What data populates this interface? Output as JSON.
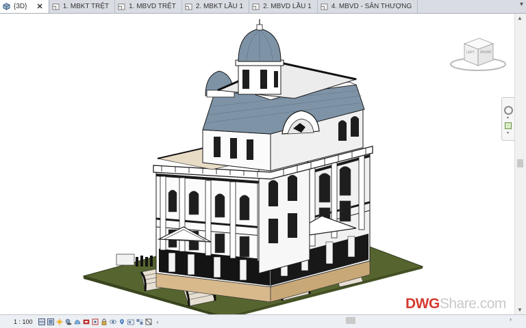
{
  "tabs": [
    {
      "label": "{3D}",
      "active": true,
      "icon": "3d-view-icon"
    },
    {
      "label": "1. MBKT TRỆT",
      "active": false,
      "icon": "floor-plan-icon"
    },
    {
      "label": "1. MBVD TRỆT",
      "active": false,
      "icon": "floor-plan-icon"
    },
    {
      "label": "2. MBKT LẦU 1",
      "active": false,
      "icon": "floor-plan-icon"
    },
    {
      "label": "2. MBVD LẦU 1",
      "active": false,
      "icon": "floor-plan-icon"
    },
    {
      "label": "4. MBVD - SÂN THƯỢNG",
      "active": false,
      "icon": "floor-plan-icon"
    }
  ],
  "viewcube": {
    "left": "LEFT",
    "front": "FRONT"
  },
  "status": {
    "scale": "1 : 100"
  },
  "watermark": {
    "part1": "DWG",
    "part2": "Share.com"
  },
  "colors": {
    "roof": "#7e93a6",
    "ground": "#5b6b36",
    "walls": "#ffffff",
    "dark": "#151515",
    "base": "#d8b98c",
    "tabbar": "#d9dde3",
    "watermark_red": "#d43a30"
  }
}
